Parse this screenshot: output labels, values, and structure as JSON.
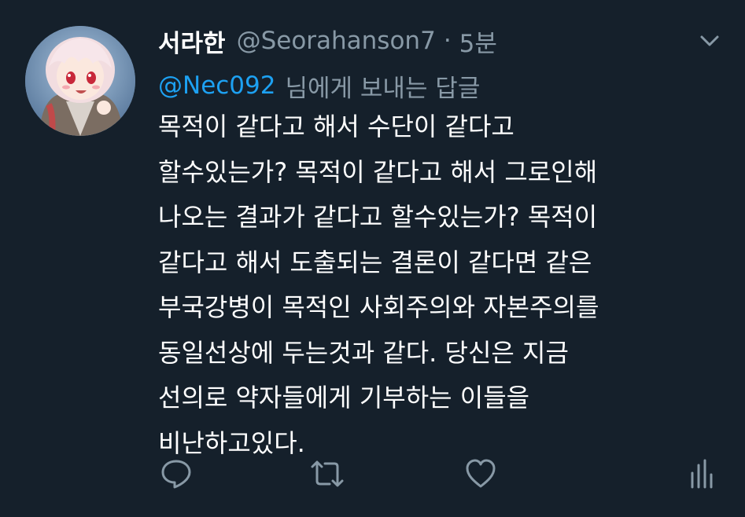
{
  "tweet": {
    "display_name": "서라한",
    "handle": "@Seorahanson7",
    "separator": "·",
    "timestamp": "5분",
    "reply_to": {
      "mention": "@Nec092",
      "suffix": "님에게 보내는 답글"
    },
    "body_lines": [
      "목적이 같다고 해서 수단이 같다고",
      "할수있는가? 목적이 같다고 해서 그로인해",
      "나오는 결과가 같다고 할수있는가? 목적이",
      "같다고 해서 도출되는 결론이 같다면 같은",
      "부국강병이 목적인 사회주의와 자본주의를",
      "동일선상에 두는것과 같다. 당신은 지금",
      "선의로 약자들에게 기부하는 이들을",
      "비난하고있다."
    ]
  },
  "actions": {
    "reply_icon": "speech-bubble-icon",
    "retweet_icon": "retweet-arrows-icon",
    "like_icon": "heart-icon",
    "analytics_icon": "bar-chart-icon"
  },
  "colors": {
    "background": "#15202b",
    "text": "#ffffff",
    "secondary": "#8899a6",
    "link": "#1da1f2"
  }
}
